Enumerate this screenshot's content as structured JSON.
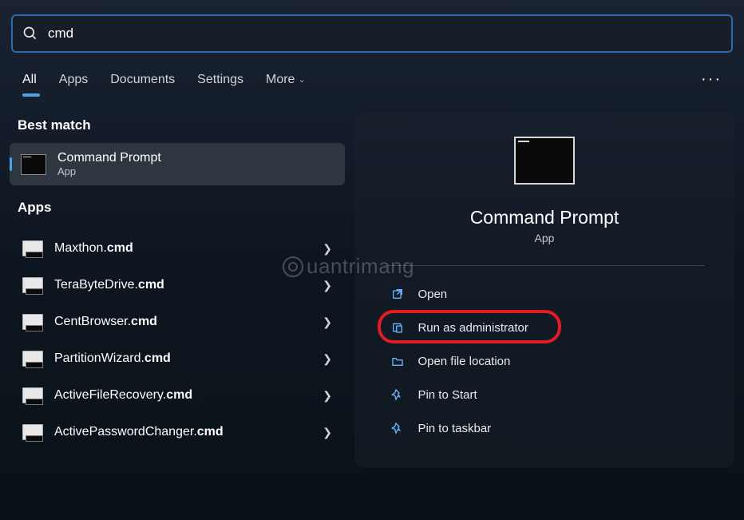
{
  "search": {
    "value": "cmd"
  },
  "tabs": {
    "all": "All",
    "apps": "Apps",
    "documents": "Documents",
    "settings": "Settings",
    "more": "More"
  },
  "sections": {
    "best_match": "Best match",
    "apps": "Apps"
  },
  "best": {
    "title": "Command Prompt",
    "sub": "App"
  },
  "apps_list": [
    {
      "name": "Maxthon.",
      "ext": "cmd"
    },
    {
      "name": "TeraByteDrive.",
      "ext": "cmd"
    },
    {
      "name": "CentBrowser.",
      "ext": "cmd"
    },
    {
      "name": "PartitionWizard.",
      "ext": "cmd"
    },
    {
      "name": "ActiveFileRecovery.",
      "ext": "cmd"
    },
    {
      "name": "ActivePasswordChanger.",
      "ext": "cmd"
    }
  ],
  "details": {
    "title": "Command Prompt",
    "sub": "App"
  },
  "actions": {
    "open": "Open",
    "run_admin": "Run as administrator",
    "open_loc": "Open file location",
    "pin_start": "Pin to Start",
    "pin_taskbar": "Pin to taskbar"
  },
  "watermark": "uantrimang"
}
